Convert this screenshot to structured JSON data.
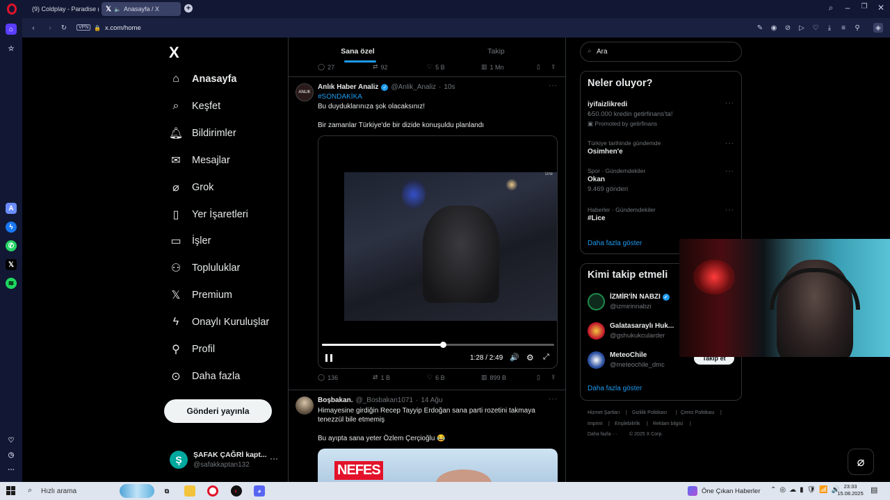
{
  "browser": {
    "tabs": [
      {
        "label": "(9) Coldplay - Paradise (Of",
        "active": false
      },
      {
        "label": "Anasayfa / X",
        "active": true
      }
    ],
    "url": "x.com/home",
    "vpn_label": "VPN"
  },
  "nav": {
    "logo": "X",
    "items": [
      {
        "label": "Anasayfa",
        "icon": "home-icon"
      },
      {
        "label": "Keşfet",
        "icon": "search-icon"
      },
      {
        "label": "Bildirimler",
        "icon": "bell-icon"
      },
      {
        "label": "Mesajlar",
        "icon": "mail-icon"
      },
      {
        "label": "Grok",
        "icon": "grok-icon"
      },
      {
        "label": "Yer İşaretleri",
        "icon": "bookmark-icon"
      },
      {
        "label": "İşler",
        "icon": "briefcase-icon"
      },
      {
        "label": "Topluluklar",
        "icon": "communities-icon"
      },
      {
        "label": "Premium",
        "icon": "x-premium-icon"
      },
      {
        "label": "Onaylı Kuruluşlar",
        "icon": "lightning-icon"
      },
      {
        "label": "Profil",
        "icon": "profile-icon"
      },
      {
        "label": "Daha fazla",
        "icon": "more-circle-icon"
      }
    ],
    "post_button": "Gönderi yayınla",
    "account": {
      "name": "ŞAFAK ÇAĞRİ kapt...",
      "handle": "@safakkaptan132",
      "avatar_letter": "Ş"
    }
  },
  "timeline": {
    "tabs": [
      {
        "label": "Sana özel",
        "active": true
      },
      {
        "label": "Takip",
        "active": false
      }
    ],
    "prev_actions": {
      "replies": "27",
      "reposts": "92",
      "likes": "5 B",
      "views": "1 Mn"
    },
    "tweet1": {
      "name": "Anlık Haber Analiz",
      "handle": "@Anlik_Analiz",
      "time": "10s",
      "hashtag": "#SONDAKİKA",
      "line1": "Bu duyduklarınıza şok olacaksınız!",
      "line2": "Bir zamanlar Türkiye'de bir dizide konuşuldu planlandı",
      "video_time": "1:28 / 2:49",
      "progress": 0.52,
      "replies": "136",
      "reposts": "1 B",
      "likes": "6 B",
      "views": "899 B"
    },
    "tweet2": {
      "name": "Boşbakan.",
      "handle": "@_Bosbakan1071",
      "time": "14 Ağu",
      "line1": "Himayesine girdiğin Recep Tayyip Erdoğan sana parti rozetini takmaya",
      "line2": "tenezzül bile etmemiş",
      "line3": "Bu ayıpta sana yeter Özlem Çerçioğlu 😂",
      "media_text": "NEFES"
    }
  },
  "sidebar": {
    "search_placeholder": "Ara",
    "trends_title": "Neler oluyor?",
    "trends": [
      {
        "meta": "",
        "title": "iyifaizlikredi",
        "sub": "₺50.000 kredin getirfinans'ta!",
        "extra": "Promoted by getirfinans"
      },
      {
        "meta": "Türkiye tarihinde gündemde",
        "title": "Osimhen'e",
        "sub": "",
        "extra": ""
      },
      {
        "meta": "Spor · Gündemdekiler",
        "title": "Okan",
        "sub": "9.469 gönderi",
        "extra": ""
      },
      {
        "meta": "Haberler · Gündemdekiler",
        "title": "#Lice",
        "sub": "",
        "extra": ""
      }
    ],
    "show_more": "Daha fazla göster",
    "who_title": "Kimi takip etmeli",
    "who": [
      {
        "name": "İZMİR'İN NABZI",
        "handle": "@izmirinnabzi"
      },
      {
        "name": "Galatasaraylı Huk...",
        "handle": "@gshukukcularder"
      },
      {
        "name": "MeteoChile",
        "handle": "@meteochile_dmc"
      }
    ],
    "follow_button": "Takip et",
    "who_more": "Daha fazla göster",
    "footer": [
      "Hizmet Şartları",
      "Gizlilik Politikası",
      "Çerez Politikası",
      "Imprint",
      "Erişilebilirlik",
      "Reklam bilgisi",
      "Daha fazla ···",
      "© 2025 X Corp."
    ]
  },
  "taskbar": {
    "search_placeholder": "Hızlı arama",
    "news": "Öne Çıkan Haberler",
    "time": "23:33",
    "date": "15.08.2025"
  },
  "colors": {
    "accent": "#1d9bf0",
    "opera_red": "#e0132a",
    "spotify": "#1ed760",
    "whatsapp": "#25d366"
  }
}
